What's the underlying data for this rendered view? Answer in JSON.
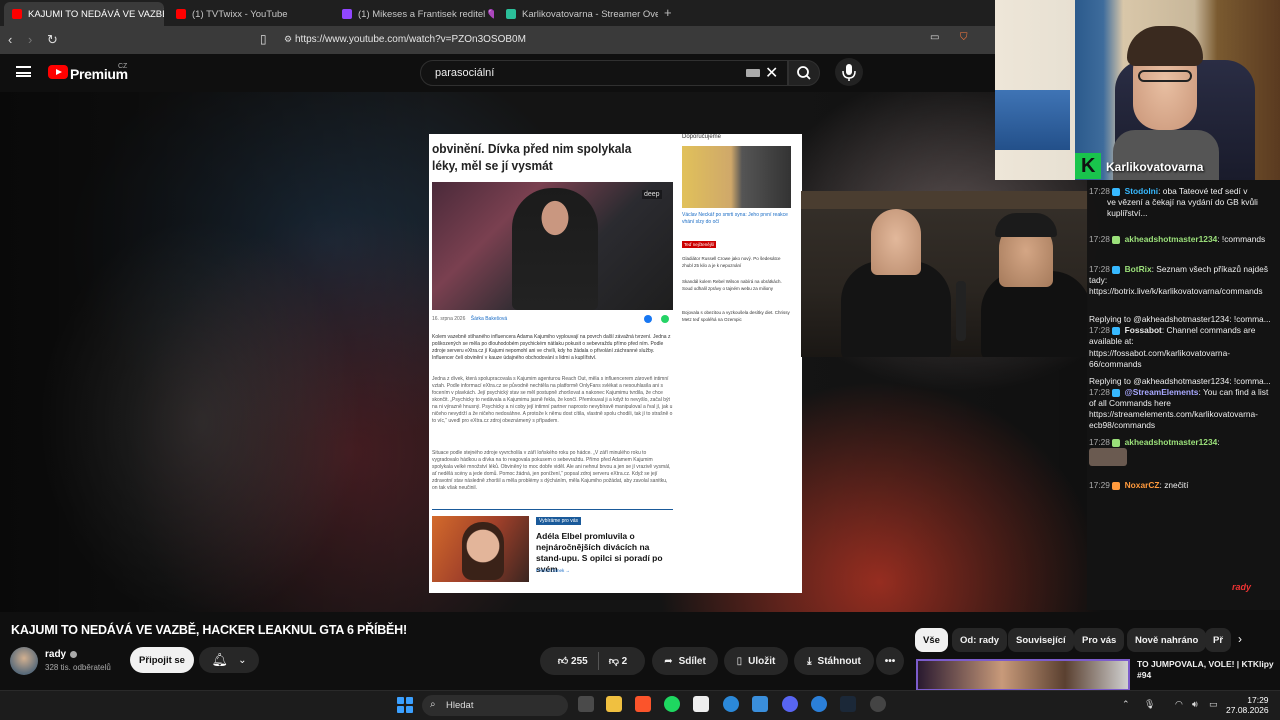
{
  "browser": {
    "tabs": [
      {
        "label": "KAJUMI TO NEDÁVÁ VE VAZBĚ,",
        "active": true,
        "close": "✕"
      },
      {
        "label": "(1) TVTwixx - YouTube"
      },
      {
        "label": "(1) Mikeses a Frantisek reditel 💜 - T"
      },
      {
        "label": "Karlikovatovarna - Streamer Overvie"
      }
    ],
    "new_tab": "+",
    "url": "https://www.youtube.com/watch?v=PZOn3OSOB0M"
  },
  "youtube": {
    "logo_text": "Premium",
    "logo_region": "CZ",
    "search_query": "parasociální"
  },
  "article": {
    "headline": "obvinění. Dívka před nim spolykala léky, měl se jí vysmát",
    "photo_badge": "deep",
    "meta_date": "16. srpna 2026",
    "meta_author": "Šárka Bakešová",
    "paragraphs": [
      "Kolem vazebně stíhaného influencera Adama Kajumiho vyplouvají na povrch další závažná tvrzení. Jedna z poškozených se měla po dlouhodobém psychickém nátlaku pokusit o sebevraždu přímo před ním. Podle zdroje serveru eXtra.cz jí Kajumi nepomohl ani ve chvíli, kdy ho žádala o přivolání záchranné služby. Influencer čelí obvinění v kauze údajného obchodování s lidmi a kuplířství.",
      "Jedna z dívek, která spolupracovala s Kajumim agenturou Reach Out, měla s influencerem zároveň intimní vztah. Podle informací eXtra.cz se původně nechtěla na platformě OnlyFans svlékat a nesouhlasila ani s focením v plavkách. Její psychický stav se měl postupně zhoršovat a nakonec Kajumimu tvrdila, že chce skončit. „Psychicky to nedávala a Kajumimu jasně řekla, že končí. Přemlouval ji a když to nevyšlo, začal být na ni výrazně hnusný. Psychicky a ni coby její intimní partner naprosto nevybíravě manipuloval a řval jí, jak u ničeho nevydrží a že ničeho nedosáhne. A protože k němu dost cítila, vlastně spolu chodili, tak jí to strašně o to víc,“ uvedl pro eXtra.cz zdroj obeznámený s případem.",
      "Situace podle stejného zdroje vyvrcholila v září loňského roku po hádce. „V září minulého roku to vygradovalo hádkou a dívka na to reagovala pokusem o sebevraždu. Přímo před Adamem Kajumim spolykala velké množství léků. Obviněný to moc dobře viděl. Ale ani nehnul brvou a jen se jí vrazivě vysmál, ať nedělá scény a jede domů. Pomoc žádná, jen ponížení,“ popsal zdroj serveru eXtra.cz. Když se její zdravotní stav následně zhoršil a měla problémy s dýcháním, měla Kajumiho požádat, aby zavolal sanitku, on tak však neučinil."
    ],
    "rec_tag": "Vybíráme pro vás",
    "rec_title": "Adéla Elbel promluvila o nejnáročnějších divácích na stand-upu. S opilci si poradí po svém",
    "rec_more": "Přečíst článek →",
    "side_heading": "Doporučujeme",
    "side_caption": "Václav Neckář po smrti syna: Jeho první reakce vhání slzy do očí",
    "side_tag": "Teď nejčtenější",
    "side_items": [
      "Gladiátor Russell Crowe jako nový. Po šedesátce zhubl 25 kilo a je k nepoznání",
      "Skandál kolem Rebel Wilson nabírá na obrátkách. Soud odhalil zprávy o tajném webu za miliony",
      "Bojovala s obezitou a vyzkoušela desítky diet. Chrissy Metz teď spoléhá na Ozempic"
    ]
  },
  "stream": {
    "streamer_name": "Karlikovatovarna",
    "chat": [
      {
        "time": "17:28",
        "user": "Stodolni",
        "color": "#37b9ff",
        "msg": "oba Tateové teď sedí v"
      },
      {
        "time": "",
        "user": "",
        "color": "",
        "msg": "ve vězení a čekají na vydání do GB kvůli kuplířství..."
      },
      {
        "time": "17:28",
        "user": "akheadshotmaster1234",
        "color": "#9be07a",
        "msg": "!commands"
      },
      {
        "time": "17:28",
        "user": "BotRix",
        "color": "#9be07a",
        "msg": "Seznam všech příkazů najdeš tady:"
      },
      {
        "time": "",
        "user": "",
        "color": "",
        "msg": "https://botrix.live/k/karlikovatovarna/commands"
      },
      {
        "time": "",
        "user": "",
        "color": "",
        "msg": "Replying to @akheadshotmaster1234: !comma..."
      },
      {
        "time": "17:28",
        "user": "Fossabot",
        "color": "#e8e8e8",
        "msg": "Channel commands are available at:"
      },
      {
        "time": "",
        "user": "",
        "color": "",
        "msg": "https://fossabot.com/karlikovatovarna-66/commands"
      },
      {
        "time": "",
        "user": "",
        "color": "",
        "msg": "Replying to @akheadshotmaster1234: !comma..."
      },
      {
        "time": "17:28",
        "user": "@StreamElements",
        "color": "#a8a8ff",
        "msg": "You can find a list of all Commands here"
      },
      {
        "time": "",
        "user": "",
        "color": "",
        "msg": "https://streamelements.com/karlikovatovarna-ecb98/commands"
      },
      {
        "time": "17:28",
        "user": "akheadshotmaster1234",
        "color": "#9be07a",
        "msg": ""
      },
      {
        "time": "17:29",
        "user": "NoxarCZ",
        "color": "#ff9a3d",
        "msg": "znečití"
      }
    ],
    "chat_logo": "rady"
  },
  "video": {
    "title": "KAJUMI TO NEDÁVÁ VE VAZBĚ, HACKER LEAKNUL GTA 6 PŘÍBĚH!",
    "channel": "rady",
    "subscribers": "328 tis. odběratelů",
    "join": "Připojit se",
    "likes": "255",
    "dislikes": "2",
    "share": "Sdílet",
    "save": "Uložit",
    "download": "Stáhnout",
    "more": "•••"
  },
  "chips": [
    "Vše",
    "Od: rady",
    "Související",
    "Pro vás",
    "Nově nahráno",
    "Př"
  ],
  "recommended": {
    "title": "TO JUMPOVALA, VOLE! | KTKlipy #94"
  },
  "taskbar": {
    "search": "Hledat",
    "time": "17:29",
    "date": "27.08.2026"
  },
  "colors": {
    "youtube_red": "#ff0000",
    "kick_green": "#19c44c",
    "link_blue": "#7fa8ff"
  }
}
